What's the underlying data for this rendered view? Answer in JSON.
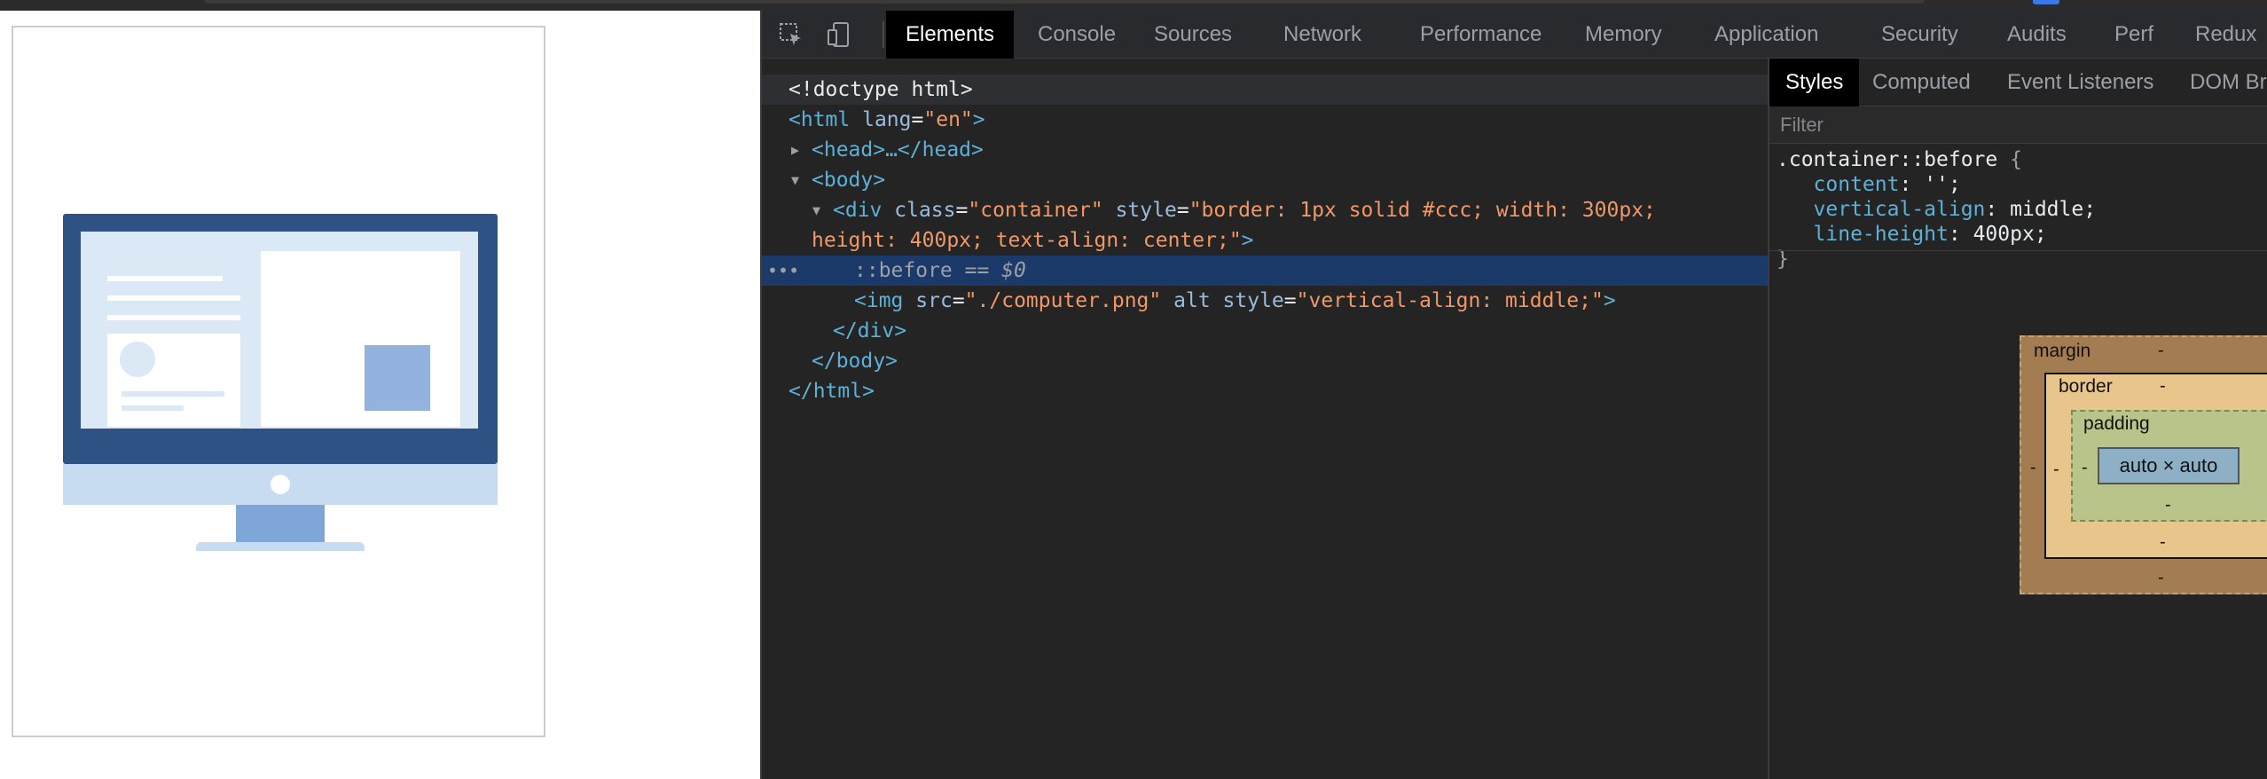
{
  "devtools": {
    "tabs": [
      "Elements",
      "Console",
      "Sources",
      "Network",
      "Performance",
      "Memory",
      "Application",
      "Security",
      "Audits",
      "Perf",
      "Redux"
    ],
    "active_tab": "Elements"
  },
  "dom": {
    "doctype": "<!doctype html>",
    "html_open_tag": "html",
    "html_attr": "lang",
    "html_attr_val": "en",
    "head_collapsed": "<head>…</head>",
    "body_open": "<body>",
    "div_tag": "div",
    "div_class_attr": "class",
    "div_class_val": "container",
    "div_style_attr": "style",
    "div_style_val_1": "border: 1px solid #ccc; width: 300px;",
    "div_style_val_2": "height: 400px; text-align: center;",
    "pseudo": "::before",
    "selected_marker": "== $0",
    "img_tag": "img",
    "img_src_attr": "src",
    "img_src_val": "./computer.png",
    "img_alt_attr": "alt",
    "img_style_attr": "style",
    "img_style_val": "vertical-align: middle;",
    "div_close": "</div>",
    "body_close": "</body>",
    "html_close": "</html>"
  },
  "styles_panel": {
    "tabs": [
      "Styles",
      "Computed",
      "Event Listeners",
      "DOM Br"
    ],
    "active_tab": "Styles",
    "filter_placeholder": "Filter",
    "selector": ".container::before",
    "declarations": [
      {
        "prop": "content",
        "value": "'';"
      },
      {
        "prop": "vertical-align",
        "value": "middle;"
      },
      {
        "prop": "line-height",
        "value": "400px;"
      }
    ]
  },
  "box_model": {
    "margin_label": "margin",
    "border_label": "border",
    "padding_label": "padding",
    "content_label": "auto × auto",
    "dash": "-"
  },
  "colors": {
    "devtools_bg": "#242424",
    "selection": "#1b3a6a",
    "tag": "#5db0d7",
    "attr_value": "#f29766"
  }
}
